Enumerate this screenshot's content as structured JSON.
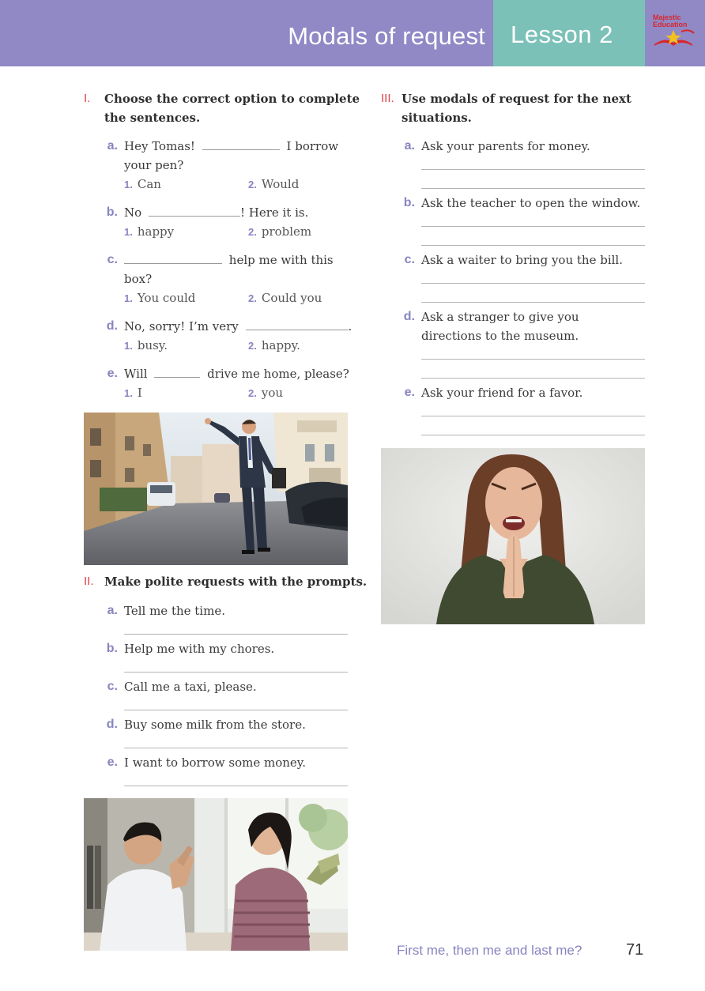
{
  "header": {
    "topic": "Modals of request",
    "lesson": "Lesson 2",
    "logo_line1": "Majestic",
    "logo_line2": "Education"
  },
  "section1": {
    "number": "I.",
    "instruction_line1": "Choose the correct option to complete",
    "instruction_line2": "the sentences.",
    "items": [
      {
        "letter": "a.",
        "pre": "Hey Tomas!",
        "post": "I borrow",
        "line2": "your pen?",
        "opt1": "Can",
        "opt2": "Would"
      },
      {
        "letter": "b.",
        "pre": "No",
        "post": "! Here it is.",
        "opt1": "happy",
        "opt2": "problem"
      },
      {
        "letter": "c.",
        "post": "help me with this",
        "line2": "box?",
        "opt1": "You could",
        "opt2": "Could you"
      },
      {
        "letter": "d.",
        "pre": "No, sorry! I’m very",
        "post": ".",
        "opt1": "busy.",
        "opt2": "happy."
      },
      {
        "letter": "e.",
        "pre": "Will",
        "post": "drive me home, please?",
        "opt1": "I",
        "opt2": "you"
      }
    ],
    "opt_num1": "1.",
    "opt_num2": "2."
  },
  "section2": {
    "number": "II.",
    "instruction": "Make polite requests with the prompts.",
    "items": [
      {
        "letter": "a.",
        "text": "Tell me the time."
      },
      {
        "letter": "b.",
        "text": "Help me with my chores."
      },
      {
        "letter": "c.",
        "text": "Call me a taxi, please."
      },
      {
        "letter": "d.",
        "text": "Buy some milk from the store."
      },
      {
        "letter": "e.",
        "text": "I want to borrow some money."
      }
    ]
  },
  "section3": {
    "number": "III.",
    "instruction_line1": "Use modals of request for the next",
    "instruction_line2": "situations.",
    "items": [
      {
        "letter": "a.",
        "text": "Ask your parents for money."
      },
      {
        "letter": "b.",
        "text": "Ask the teacher to open the window."
      },
      {
        "letter": "c.",
        "text": "Ask a waiter to bring you the bill."
      },
      {
        "letter": "d.",
        "text": "Ask a stranger to give you",
        "line2": "directions to the museum."
      },
      {
        "letter": "e.",
        "text": "Ask your friend for a favor."
      }
    ]
  },
  "footer": {
    "text": "First me, then me and last me?",
    "page": "71"
  }
}
